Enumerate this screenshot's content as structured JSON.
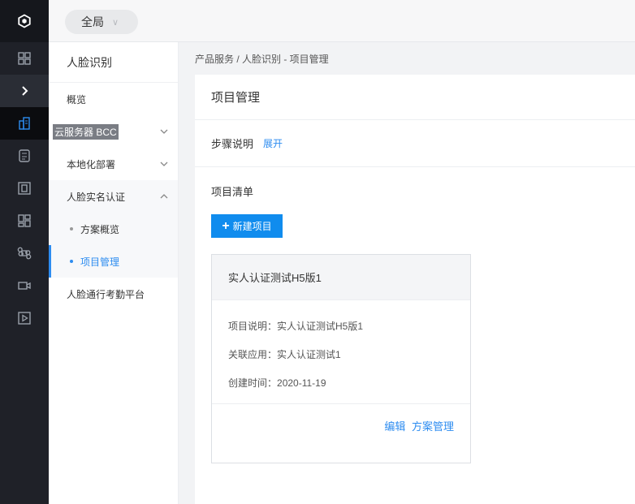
{
  "rail": {
    "icons": [
      "logo-icon",
      "grid-icon",
      "expand-icon",
      "building-icon",
      "calculator-icon",
      "device-icon",
      "apps-icon",
      "command-icon",
      "video-icon",
      "play-icon"
    ]
  },
  "topbar": {
    "scope_label": "全局",
    "scope_chevron": "∨"
  },
  "sidebar": {
    "title": "人脸识别",
    "items": [
      {
        "label": "概览"
      },
      {
        "label": "云服务器 BCC"
      },
      {
        "label": "本地化部署"
      },
      {
        "label": "人脸实名认证"
      },
      {
        "label": "方案概览"
      },
      {
        "label": "项目管理"
      },
      {
        "label": "人脸通行考勤平台"
      }
    ]
  },
  "breadcrumb": "产品服务 / 人脸识别 - 项目管理",
  "main": {
    "title": "项目管理",
    "steps_label": "步骤说明",
    "steps_toggle": "展开",
    "list_title": "项目清单",
    "new_button": "新建项目",
    "new_button_icon": "+",
    "project": {
      "name": "实人认证测试H5版1",
      "desc_label": "项目说明：",
      "desc_value": "实人认证测试H5版1",
      "app_label": "关联应用：",
      "app_value": "实人认证测试1",
      "created_label": "创建时间：",
      "created_value": "2020-11-19",
      "edit_label": "编辑",
      "manage_label": "方案管理"
    }
  },
  "colors": {
    "accent": "#2d8cf0",
    "button": "#108cee",
    "rail": "#1f2128"
  }
}
